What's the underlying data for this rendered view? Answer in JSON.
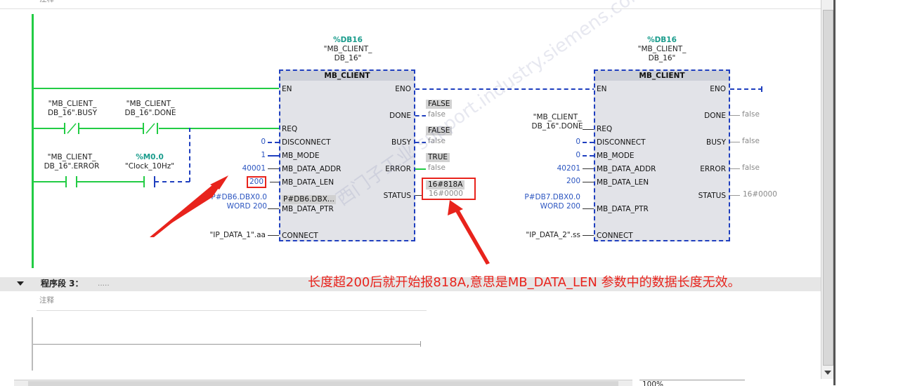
{
  "top_comment": "注释",
  "network2": {
    "block1": {
      "db": "%DB16",
      "db_name": [
        "\"MB_CLIENT_",
        "DB_16\""
      ],
      "title": "MB_CLIENT",
      "inputs": {
        "en": "EN",
        "req": "REQ",
        "disconnect": "DISCONNECT",
        "mb_mode": "MB_MODE",
        "mb_data_addr": "MB_DATA_ADDR",
        "mb_data_len": "MB_DATA_LEN",
        "mb_data_ptr": "MB_DATA_PTR",
        "connect": "CONNECT",
        "ptr_value_inside": "P#DB6.DBX..."
      },
      "outputs": {
        "eno": "ENO",
        "done": "DONE",
        "busy": "BUSY",
        "error": "ERROR",
        "status": "STATUS"
      },
      "values": {
        "disconnect": "0",
        "mb_mode": "1",
        "mb_data_addr": "40001",
        "mb_data_len": "200",
        "ptr_line1": "P#DB6.DBX0.0",
        "ptr_line2": "WORD 200",
        "connect": "\"IP_DATA_1\".aa"
      },
      "monitor": {
        "done_top": "FALSE",
        "done_bottom": "false",
        "busy_top": "FALSE",
        "busy_bottom": "false",
        "error_top": "TRUE",
        "error_bottom": "false",
        "status_top": "16#818A",
        "status_bottom": "16#0000"
      }
    },
    "block2": {
      "db": "%DB16",
      "db_name": [
        "\"MB_CLIENT_",
        "DB_16\""
      ],
      "title": "MB_CLIENT",
      "req_tag": [
        "\"MB_CLIENT_",
        "DB_16\".DONE"
      ],
      "values": {
        "disconnect": "0",
        "mb_mode": "0",
        "mb_data_addr": "40201",
        "mb_data_len": "200",
        "ptr_line1": "P#DB7.DBX0.0",
        "ptr_line2": "WORD 200",
        "connect": "\"IP_DATA_2\".ss"
      },
      "monitor": {
        "done": "false",
        "busy": "false",
        "error": "false",
        "status": "16#0000"
      }
    },
    "contacts": {
      "busy": [
        "\"MB_CLIENT_",
        "DB_16\".BUSY"
      ],
      "done": [
        "\"MB_CLIENT_",
        "DB_16\".DONE"
      ],
      "error": [
        "\"MB_CLIENT_",
        "DB_16\".ERROR"
      ],
      "clock_addr": "%M0.0",
      "clock_name": "\"Clock_10Hz\""
    }
  },
  "network3": {
    "label": "程序段 3：",
    "dots": ".....",
    "comment": "注释"
  },
  "annotation": "长度超200后就开始报818A,意思是MB_DATA_LEN 参数中的数据长度无效。",
  "watermark": "西门子工业 support.industry.siemens.com/cs 找答案",
  "zoom": "100%",
  "colors": {
    "rung": "#22cc44",
    "dashed": "#1f3fbf",
    "annotation": "#e8231c",
    "highlight": "#e8231c"
  }
}
